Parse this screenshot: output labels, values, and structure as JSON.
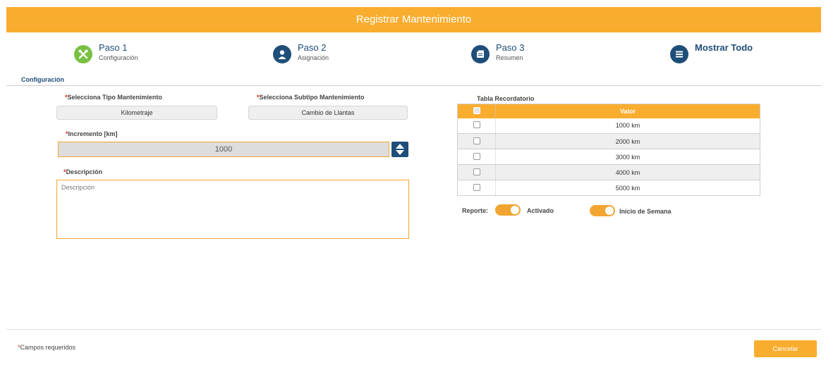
{
  "title": "Registrar Mantenimiento",
  "steps": [
    {
      "title": "Paso 1",
      "subtitle": "Configuración",
      "icon": "tools-icon",
      "color": "#7ac143"
    },
    {
      "title": "Paso 2",
      "subtitle": "Asignación",
      "icon": "user-icon",
      "color": "#1f4e79"
    },
    {
      "title": "Paso 3",
      "subtitle": "Resumen",
      "icon": "summary-icon",
      "color": "#1f4e79"
    },
    {
      "title": "Mostrar Todo",
      "subtitle": "",
      "icon": "menu-icon",
      "color": "#1f4e79"
    }
  ],
  "section": "Configuración",
  "form": {
    "required_mark": "*",
    "tipo_label": "Selecciona Tipo Mantenimiento",
    "tipo_value": "Kilometraje",
    "subtipo_label": "Selecciona Subtipo Mantenimiento",
    "subtipo_value": "Cambio de Llantas",
    "incremento_label": "Incremento [km]",
    "incremento_value": "1000",
    "descripcion_label": "Descripción",
    "descripcion_placeholder": "Descripción"
  },
  "table": {
    "title": "Tabla Recordatorio",
    "header": "Valor",
    "rows": [
      "1000 km",
      "2000 km",
      "3000 km",
      "4000 km",
      "5000 km"
    ]
  },
  "toggles": {
    "reporte_label": "Reporte:",
    "activado_label": "Activado",
    "inicio_label": "Inicio de Semana"
  },
  "footer": {
    "required_note": "Campos requeridos",
    "cancel": "Cancelar"
  },
  "colors": {
    "accent": "#f9ad2f",
    "primary": "#1f4e79",
    "required": "#e0211a"
  }
}
